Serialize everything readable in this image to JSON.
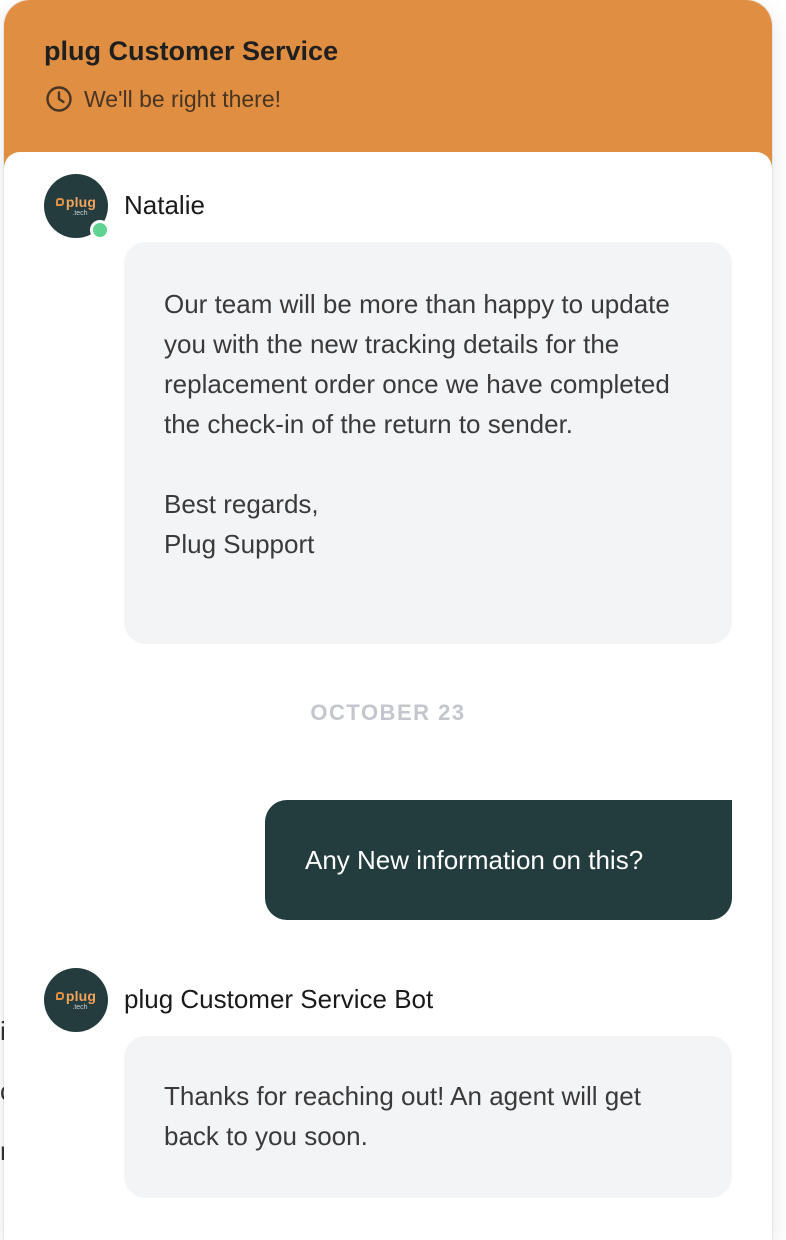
{
  "header": {
    "title": "plug Customer Service",
    "status": "We'll be right there!",
    "status_icon": "clock-icon",
    "color": "#e08e42"
  },
  "logo": {
    "word": "plug",
    "sub": ".tech"
  },
  "messages": [
    {
      "sender": "Natalie",
      "online": true,
      "paragraphs": [
        "Our team will be more than happy to update you with the new tracking details for the replacement order once we have completed the check-in of the return to sender.",
        "Best regards,\nPlug Support"
      ]
    },
    {
      "sender": "plug Customer Service Bot",
      "paragraphs": [
        "Thanks for reaching out! An agent will get back to you soon."
      ]
    }
  ],
  "date_separator": "OCTOBER 23",
  "user_message": "Any New information on this?",
  "user_bubble_color": "#233c3e"
}
